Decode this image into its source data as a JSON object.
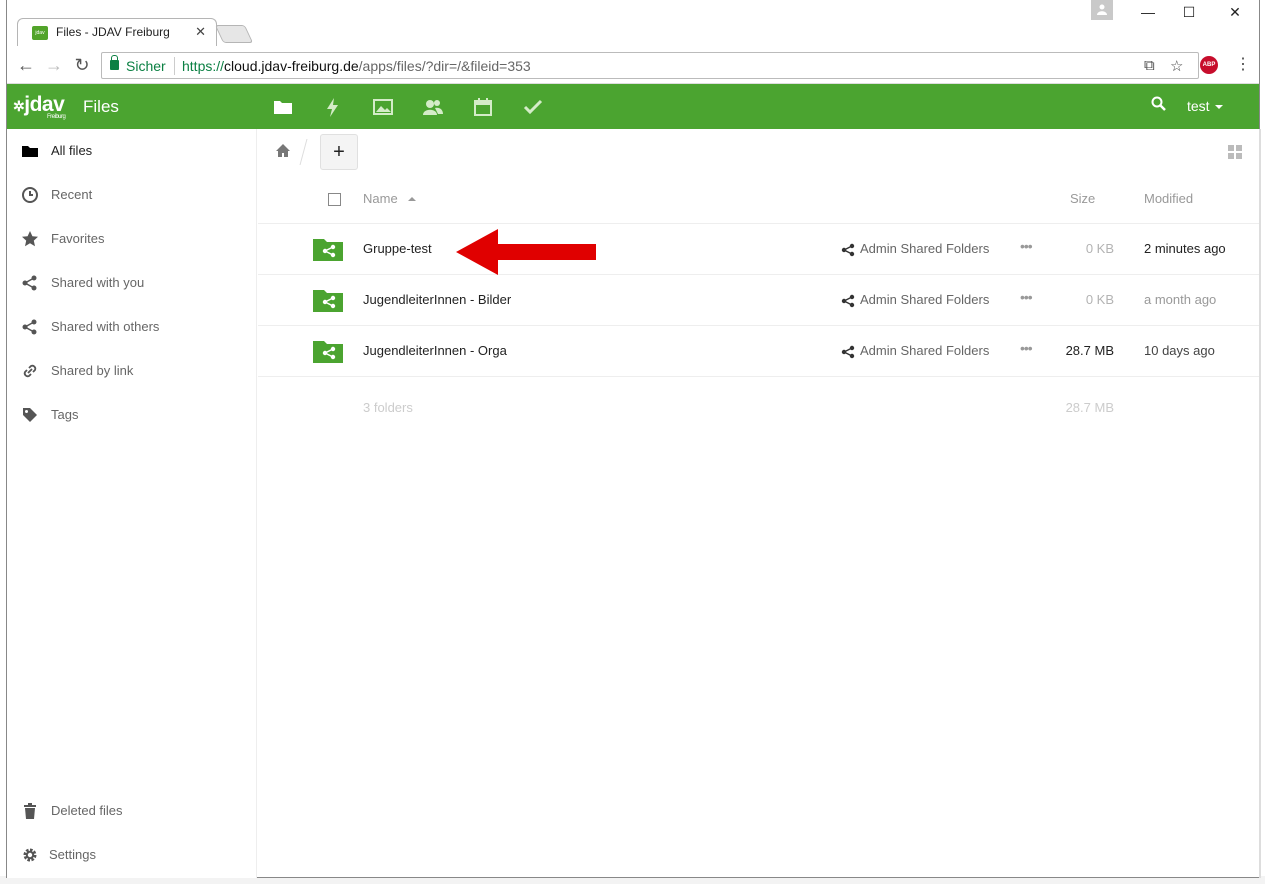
{
  "browser": {
    "tab_title": "Files - JDAV Freiburg",
    "tab_favicon_text": "jdav",
    "secure_label": "Sicher",
    "url_scheme": "https://",
    "url_host": "cloud.jdav-freiburg.de",
    "url_path": "/apps/files/?dir=/&fileid=353",
    "abp_label": "ABP"
  },
  "header": {
    "logo_text": "jdav",
    "logo_sub": "Freiburg",
    "app_name": "Files",
    "user": "test",
    "brand_color": "#4ba430",
    "apps": [
      "files-icon",
      "activity-icon",
      "gallery-icon",
      "contacts-icon",
      "calendar-icon",
      "tasks-icon"
    ]
  },
  "sidebar": {
    "items": [
      {
        "label": "All files",
        "icon": "folder-icon"
      },
      {
        "label": "Recent",
        "icon": "clock-icon"
      },
      {
        "label": "Favorites",
        "icon": "star-icon"
      },
      {
        "label": "Shared with you",
        "icon": "share-icon"
      },
      {
        "label": "Shared with others",
        "icon": "share-icon"
      },
      {
        "label": "Shared by link",
        "icon": "link-icon"
      },
      {
        "label": "Tags",
        "icon": "tag-icon"
      }
    ],
    "deleted_files": "Deleted files",
    "settings": "Settings"
  },
  "table": {
    "headers": {
      "name": "Name",
      "size": "Size",
      "modified": "Modified"
    },
    "rows": [
      {
        "name": "Gruppe-test",
        "share": "Admin Shared Folders",
        "size": "0 KB",
        "modified": "2 minutes ago",
        "size_color": "#b3b3b3",
        "mod_color": "#222222"
      },
      {
        "name": "JugendleiterInnen - Bilder",
        "share": "Admin Shared Folders",
        "size": "0 KB",
        "modified": "a month ago",
        "size_color": "#b3b3b3",
        "mod_color": "#999999"
      },
      {
        "name": "JugendleiterInnen - Orga",
        "share": "Admin Shared Folders",
        "size": "28.7 MB",
        "modified": "10 days ago",
        "size_color": "#222222",
        "mod_color": "#444444"
      }
    ],
    "summary_count": "3 folders",
    "summary_size": "28.7 MB",
    "more_glyph": "•••"
  },
  "new_button": "+"
}
